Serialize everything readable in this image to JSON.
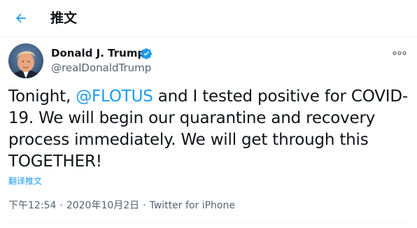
{
  "header": {
    "back_icon": "arrow-left-icon",
    "title": "推文"
  },
  "tweet": {
    "author": {
      "name": "Donald J. Trump",
      "handle": "@realDonaldTrump",
      "verified_icon": "verified-badge-icon"
    },
    "more_icon": "more-dots-icon",
    "text_before": "Tonight, ",
    "mention": "@FLOTUS",
    "text_after": " and I tested positive for COVID-19. We will begin our quarantine and recovery process immediately. We will get through this TOGETHER!",
    "translate_label": "翻译推文",
    "time": "下午12:54",
    "date": "2020年10月2日",
    "separator": "·",
    "source": "Twitter for iPhone"
  },
  "colors": {
    "accent": "#1d9bf0",
    "text": "#0f1419",
    "secondary": "#536471",
    "divider": "#eff3f4"
  }
}
